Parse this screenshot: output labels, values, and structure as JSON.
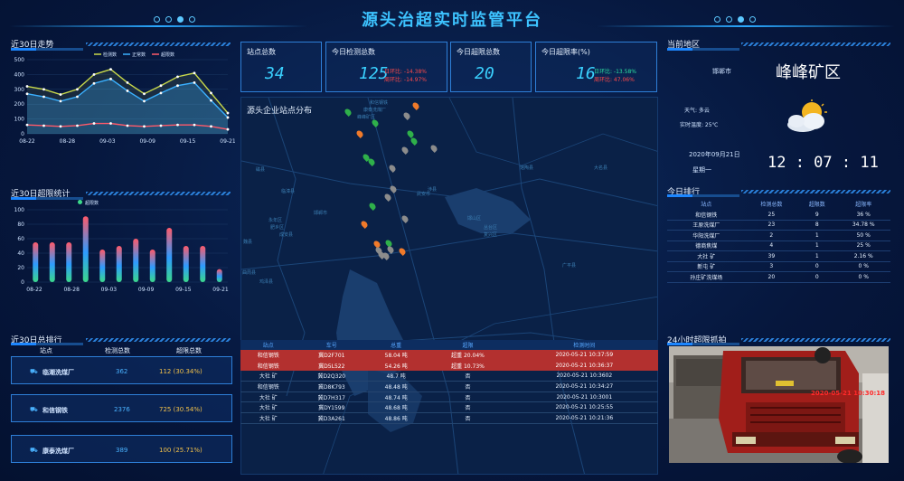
{
  "header": {
    "title": "源头治超实时监管平台"
  },
  "trend": {
    "title": "近30日走势"
  },
  "overload_stats": {
    "title": "近30日超限统计"
  },
  "total_rank": {
    "title": "近30日总排行",
    "columns": [
      "站点",
      "检测总数",
      "超限总数"
    ],
    "rows": [
      {
        "name": "临潮洗煤厂",
        "total": "362",
        "over": "112 (30.34%)"
      },
      {
        "name": "和信钢铁",
        "total": "2376",
        "over": "725 (30.54%)"
      },
      {
        "name": "康泰洗煤厂",
        "total": "389",
        "over": "100 (25.71%)"
      }
    ]
  },
  "kpis": [
    {
      "label": "站点总数",
      "value": "34"
    },
    {
      "label": "今日检测总数",
      "value": "125",
      "mom": "日环比: -14.38%",
      "wow": "周环比: -14.97%"
    },
    {
      "label": "今日超限总数",
      "value": "20"
    },
    {
      "label": "今日超限率(%)",
      "value": "16",
      "mom": "日环比: -13.58%",
      "wow": "周环比: 47.06%"
    }
  ],
  "map": {
    "title": "源头企业站点分布",
    "labels": [
      "和信钢铁",
      "康泰洗煤厂",
      "峰峰矿区",
      "磁县",
      "临漳县",
      "邯郸市",
      "永年区",
      "肥乡区",
      "成安县",
      "魏县",
      "曲周县",
      "鸡泽县",
      "武安市",
      "涉县",
      "馆陶县",
      "大名县",
      "邯山区",
      "丛台区",
      "复兴区",
      "广平县"
    ],
    "pin_colors": [
      "#2fb04a",
      "#f07a2a",
      "#8c8c8c"
    ]
  },
  "current": {
    "title": "当前地区",
    "city": "邯郸市",
    "district": "峰峰矿区",
    "weather": "天气: 多云",
    "temp": "实时温度: 25℃",
    "date": "2020年09月21日",
    "weekday": "星期一",
    "time": "12 : 07 : 11"
  },
  "today_rank": {
    "title": "今日排行",
    "columns": [
      "站点",
      "检测总数",
      "超限数",
      "超限率"
    ],
    "rows": [
      {
        "name": "和信钢铁",
        "total": "25",
        "over": "9",
        "rate": "36 %"
      },
      {
        "name": "王原洗煤厂",
        "total": "23",
        "over": "8",
        "rate": "34.78 %"
      },
      {
        "name": "华阳洗煤厂",
        "total": "2",
        "over": "1",
        "rate": "50 %"
      },
      {
        "name": "德商焦煤",
        "total": "4",
        "over": "1",
        "rate": "25 %"
      },
      {
        "name": "大社 矿",
        "total": "39",
        "over": "1",
        "rate": "2.16 %"
      },
      {
        "name": "新屯 矿",
        "total": "3",
        "over": "0",
        "rate": "0 %"
      },
      {
        "name": "孙庄矿洗煤场",
        "total": "20",
        "over": "0",
        "rate": "0 %"
      }
    ]
  },
  "records": {
    "columns": [
      "站点",
      "车号",
      "总重",
      "超限",
      "检测时间"
    ],
    "rows": [
      {
        "site": "和信钢铁",
        "plate": "冀D2F701",
        "weight": "58.04 吨",
        "over": "超重 20.04%",
        "time": "2020-05-21 10:37:59",
        "alert": true
      },
      {
        "site": "和信钢铁",
        "plate": "冀D5L522",
        "weight": "54.26 吨",
        "over": "超重 10.73%",
        "time": "2020-05-21 10:36:37",
        "alert": true
      },
      {
        "site": "大社 矿",
        "plate": "冀D2Q320",
        "weight": "48.7 吨",
        "over": "否",
        "time": "2020-05-21 10:3602",
        "alert": false
      },
      {
        "site": "和信钢铁",
        "plate": "冀D8K793",
        "weight": "48.48 吨",
        "over": "否",
        "time": "2020-05-21 10:34:27",
        "alert": false
      },
      {
        "site": "大社 矿",
        "plate": "冀D7H317",
        "weight": "48.74 吨",
        "over": "否",
        "time": "2020-05-21 10:3001",
        "alert": false
      },
      {
        "site": "大社 矿",
        "plate": "冀DY1599",
        "weight": "48.68 吨",
        "over": "否",
        "time": "2020-05-21 10:25:55",
        "alert": false
      },
      {
        "site": "大社 矿",
        "plate": "冀D3A261",
        "weight": "48.86 吨",
        "over": "否",
        "time": "2020-05-21 10:21:36",
        "alert": false
      }
    ]
  },
  "capture": {
    "title": "24小时超限抓拍",
    "stamp": "2020-05-21 10:30:18"
  },
  "chart_data": [
    {
      "type": "line",
      "title": "近30日走势",
      "legend": [
        "检测数",
        "正常数",
        "超限数"
      ],
      "x": [
        "08-22",
        "08-28",
        "09-03",
        "09-09",
        "09-15",
        "09-21"
      ],
      "ylim": [
        0,
        500
      ],
      "yticks": [
        0,
        100,
        200,
        300,
        400,
        500
      ],
      "series": [
        {
          "name": "检测数",
          "color": "#c8d84a",
          "values": [
            320,
            300,
            265,
            300,
            400,
            435,
            345,
            270,
            325,
            385,
            410,
            275,
            140
          ]
        },
        {
          "name": "正常数",
          "color": "#3ab0ff",
          "values": [
            270,
            250,
            220,
            250,
            340,
            370,
            290,
            220,
            275,
            325,
            345,
            225,
            110
          ]
        },
        {
          "name": "超限数",
          "color": "#ff5a6a",
          "values": [
            60,
            55,
            50,
            55,
            70,
            70,
            55,
            50,
            55,
            60,
            60,
            50,
            30
          ]
        }
      ]
    },
    {
      "type": "bar",
      "title": "近30日超限统计",
      "legend": [
        "超限数"
      ],
      "categories": [
        "08-22",
        "08-28",
        "09-03",
        "09-09",
        "09-15",
        "09-21"
      ],
      "ylim": [
        0,
        100
      ],
      "yticks": [
        0,
        20,
        40,
        60,
        80,
        100
      ],
      "values": [
        55,
        55,
        55,
        91,
        45,
        50,
        60,
        45,
        75,
        50,
        50,
        18
      ]
    }
  ]
}
